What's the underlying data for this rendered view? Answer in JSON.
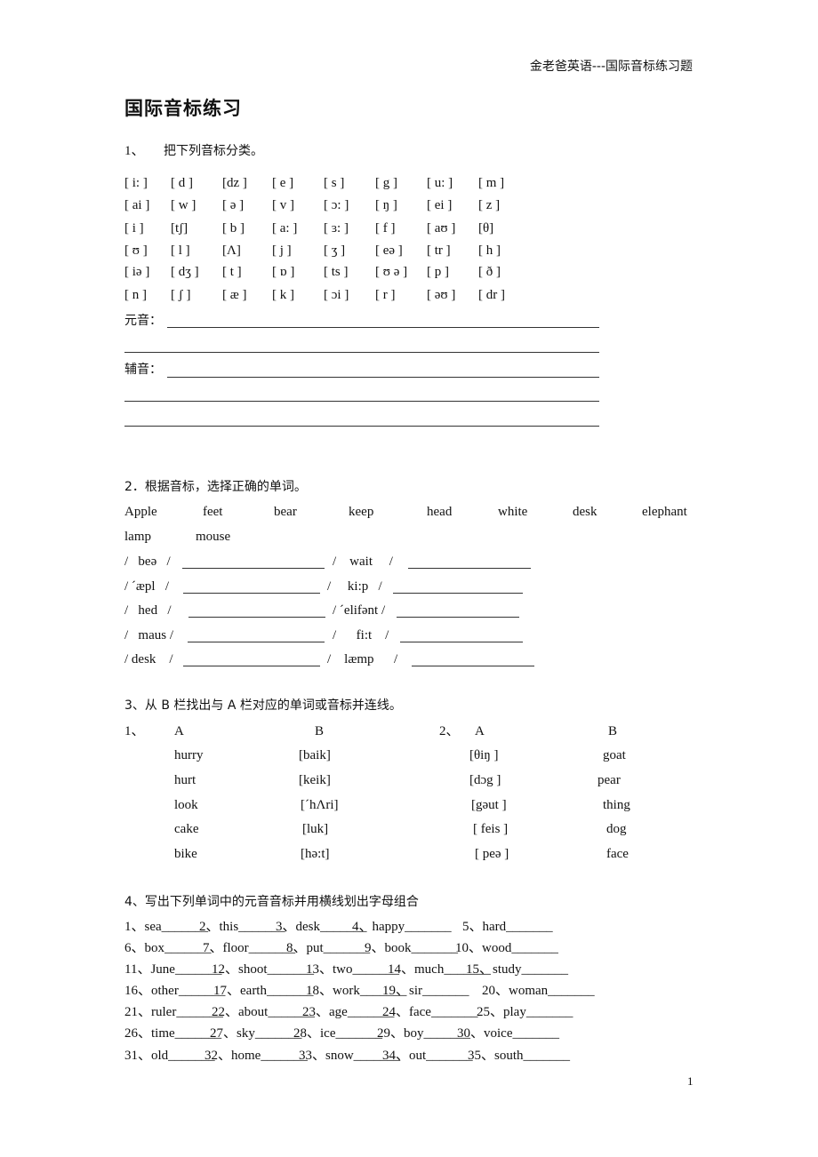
{
  "header": "金老爸英语---国际音标练习题",
  "title": "国际音标练习",
  "page_number": "1",
  "q1": {
    "label": "1、",
    "instruction": "把下列音标分类。",
    "rows": [
      [
        "[ i: ]",
        "[ d ]",
        "[dz ]",
        "[ e ]",
        "[ s ]",
        "[ g ]",
        "[ u: ]",
        "[ m ]"
      ],
      [
        "[ ai ]",
        "[ w ]",
        "[ ə ]",
        "[ v ]",
        "[ ɔ: ]",
        "[ ŋ ]",
        "[ ei ]",
        "[ z ]"
      ],
      [
        "[ i ]",
        "[tʃ]",
        "[ b ]",
        "[ a: ]",
        "[ ɜ: ]",
        "[ f ]",
        "[ aʊ ]",
        "[θ]"
      ],
      [
        "[ ʊ ]",
        "[ l ]",
        "[Λ]",
        "[ j ]",
        "[ ʒ ]",
        "[ eə ]",
        "[ tr ]",
        "[ h ]"
      ],
      [
        "[ iə ]",
        "[ dʒ ]",
        "[ t ]",
        "[ ɒ ]",
        "[ ts ]",
        "[ ʊ ə ]",
        "[ p ]",
        "[ ð ]"
      ],
      [
        "[ n ]",
        "[ ʃ ]",
        "[ æ ]",
        "[ k ]",
        "[ ɔi ]",
        "[ r ]",
        "[ əʊ ]",
        "[ dr ]"
      ]
    ],
    "vowels_label": "元音：",
    "consonants_label": "辅音："
  },
  "q2": {
    "instruction": "2．根据音标，选择正确的单词。",
    "word_bank": [
      "Apple",
      "feet",
      "bear",
      "keep",
      "head",
      "white",
      "desk",
      "elephant",
      "lamp",
      "mouse"
    ],
    "rows": [
      [
        "/   beə   /",
        "/    wait     /"
      ],
      [
        "/ ˊæpl   /",
        "/     ki:p   /"
      ],
      [
        "/   hed   /",
        "/ ˊelifənt /"
      ],
      [
        "/   maus /",
        "/      fi:t    /"
      ],
      [
        "/ desk    /",
        "/    læmp      /"
      ]
    ]
  },
  "q3": {
    "instruction": "3、从 B 栏找出与 A 栏对应的单词或音标并连线。",
    "part1": {
      "label": "1、",
      "col_a": "A",
      "col_b": "B",
      "a_items": [
        "hurry",
        "hurt",
        "look",
        "cake",
        "bike"
      ],
      "b_items": [
        "[baik]",
        "[keik]",
        "[ˊhΛri]",
        "[luk]",
        "[hə:t]"
      ]
    },
    "part2": {
      "label": "2、",
      "col_a": "A",
      "col_b": "B",
      "a_items": [
        "[θiŋ ]",
        "[dɔg ]",
        "[gəut ]",
        "[ feis ]",
        "[ peə ]"
      ],
      "b_items": [
        "goat",
        "pear",
        "thing",
        "dog",
        "face"
      ]
    }
  },
  "q4": {
    "instruction": "4、写出下列单词中的元音音标并用横线划出字母组合",
    "items": [
      "1、sea_______",
      "2、this_______",
      "3、desk_______",
      "4、happy_______",
      "5、hard_______",
      "6、box_______",
      "7、floor_______",
      "8、put_______",
      "9、book_______",
      "10、wood_______",
      "11、June_______",
      "12、shoot_______",
      "13、two_______",
      "14、much_______",
      "15、study_______",
      "16、other_______",
      "17、earth_______",
      "18、work_______",
      "19、sir_______",
      "20、woman_______",
      "21、ruler_______",
      "22、about_______",
      "23、age_______",
      "24、face_______",
      "25、play_______",
      "26、time_______",
      "27、sky_______",
      "28、ice_______",
      "29、boy_______",
      "30、voice_______",
      "31、old_______",
      "32、home_______",
      "33、snow_______",
      "34、out_______",
      "35、south_______"
    ]
  }
}
